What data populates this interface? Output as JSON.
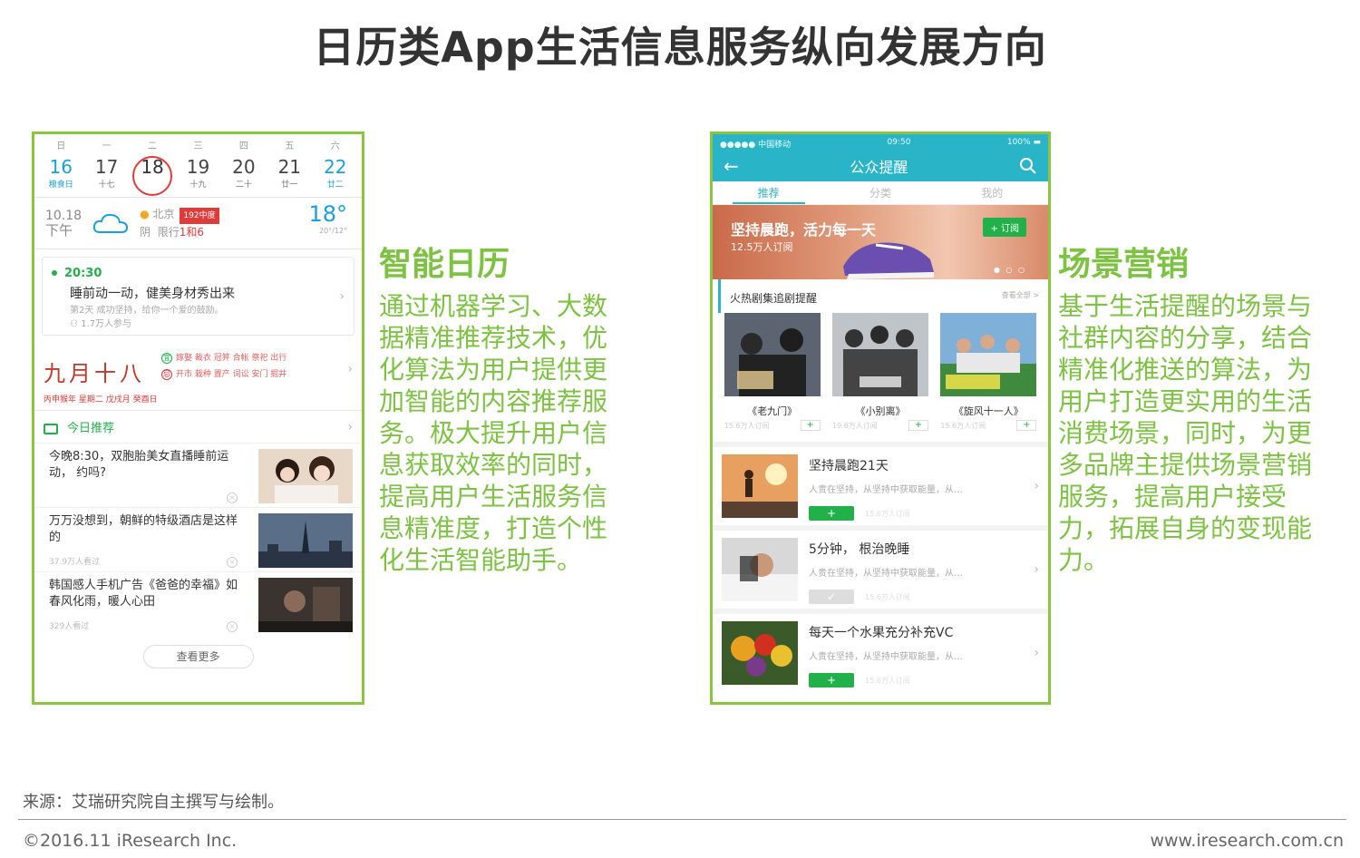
{
  "title": "日历类App生活信息服务纵向发展方向",
  "left_phone": {
    "calendar": [
      {
        "weekday": "日",
        "day": "16",
        "lunar": "粮食日",
        "style": "blue"
      },
      {
        "weekday": "一",
        "day": "17",
        "lunar": "十七",
        "style": "normal"
      },
      {
        "weekday": "二",
        "day": "18",
        "lunar": "",
        "style": "today"
      },
      {
        "weekday": "三",
        "day": "19",
        "lunar": "十九",
        "style": "normal"
      },
      {
        "weekday": "四",
        "day": "20",
        "lunar": "二十",
        "style": "normal"
      },
      {
        "weekday": "五",
        "day": "21",
        "lunar": "廿一",
        "style": "normal"
      },
      {
        "weekday": "六",
        "day": "22",
        "lunar": "廿二",
        "style": "blue"
      }
    ],
    "weather": {
      "date": "10.18",
      "period": "下午",
      "city": "北京",
      "aqi_badge": "192中度",
      "condition": "阴",
      "restriction_label": "限行",
      "restriction_value": "1和6",
      "temp": "18°",
      "range": "20°/12°"
    },
    "event": {
      "time": "20:30",
      "title": "睡前动一动，健美身材秀出来",
      "subtitle": "第2天 成功坚持，给你一个爱的鼓励。",
      "participants": "1.7万人参与"
    },
    "almanac": {
      "lunar_date": "九月十八",
      "yi": "嫁娶 裁衣 冠笄 合帐 祭祀 出行",
      "ji": "开市 栽种 置产 词讼 安门 掘井",
      "ganzhi": "丙申猴年 星期二 戊戌月 癸酉日"
    },
    "recommend": {
      "heading": "今日推荐",
      "items": [
        {
          "title": "今晚8:30，双胞胎美女直播睡前运动， 约吗?",
          "count": ""
        },
        {
          "title": "万万没想到，朝鲜的特级酒店是这样的",
          "count": "37.9万人看过"
        },
        {
          "title": "韩国感人手机广告《爸爸的幸福》如春风化雨，暖人心田",
          "count": "329人看过"
        }
      ],
      "more": "查看更多"
    }
  },
  "right_phone": {
    "status": {
      "carrier": "●●●●● 中国移动",
      "time": "09:50",
      "battery": "100%"
    },
    "nav_title": "公众提醒",
    "tabs": [
      "推荐",
      "分类",
      "我的"
    ],
    "banner": {
      "title": "坚持晨跑，活力每一天",
      "subs": "12.5万人订阅",
      "button": "+ 订阅"
    },
    "section": {
      "title": "火热剧集追剧提醒",
      "more": "查看全部 >"
    },
    "posters": [
      {
        "name": "《老九门》",
        "count": "15.6万人订阅"
      },
      {
        "name": "《小别离》",
        "count": "19.6万人订阅"
      },
      {
        "name": "《旋风十一人》",
        "count": "15.6万人订阅"
      }
    ],
    "feeds": [
      {
        "title": "坚持晨跑21天",
        "desc": "人贵在坚持，从坚持中获取能量，从…",
        "count": "15.6万人订阅",
        "button": "+",
        "subscribed": false
      },
      {
        "title": "5分钟， 根治晚睡",
        "desc": "人贵在坚持，从坚持中获取能量，从…",
        "count": "15.6万人订阅",
        "button": "✓",
        "subscribed": true
      },
      {
        "title": "每天一个水果充分补充VC",
        "desc": "人贵在坚持，从坚持中获取能量，从…",
        "count": "15.6万人订阅",
        "button": "+",
        "subscribed": false
      }
    ]
  },
  "smart_calendar": {
    "heading": "智能日历",
    "body": "通过机器学习、大数据精准推荐技术，优化算法为用户提供更加智能的内容推荐服务。极大提升用户信息获取效率的同时，提高用户生活服务信息精准度，打造个性化生活智能助手。"
  },
  "scene_marketing": {
    "heading": "场景营销",
    "body": "基于生活提醒的场景与社群内容的分享，结合精准化推送的算法，为用户打造更实用的生活消费场景，同时，为更多品牌主提供场景营销服务，提高用户接受力，拓展自身的变现能力。"
  },
  "footer": {
    "source": "来源：艾瑞研究院自主撰写与绘制。",
    "copyright": "©2016.11 iResearch Inc.",
    "website": "www.iresearch.com.cn"
  },
  "colors": {
    "accent_green": "#7dc242",
    "app_teal": "#2ab4c7",
    "calendar_blue": "#1aa0d8",
    "alert_red": "#e03b3b"
  }
}
